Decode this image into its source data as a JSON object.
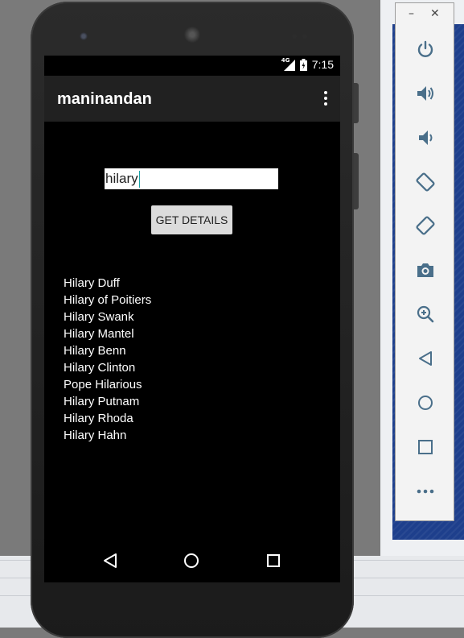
{
  "app": {
    "title": "maninandan",
    "menu_icon": "more-vert-icon"
  },
  "status_bar": {
    "network": "4G",
    "time": "7:15"
  },
  "search": {
    "value": "hilary"
  },
  "button": {
    "label": "GET DETAILS"
  },
  "results": [
    "Hilary Duff",
    "Hilary of Poitiers",
    "Hilary Swank",
    "Hilary Mantel",
    "Hilary Benn",
    "Hilary Clinton",
    "Pope Hilarious",
    "Hilary Putnam",
    "Hilary Rhoda",
    "Hilary Hahn"
  ],
  "nav_bar": [
    "back-icon",
    "home-icon",
    "recents-icon"
  ],
  "emulator_toolbar": {
    "window_controls": {
      "minimize": "–",
      "close": "✕"
    },
    "buttons": [
      "power-icon",
      "volume-up-icon",
      "volume-down-icon",
      "rotate-left-icon",
      "rotate-right-icon",
      "camera-icon",
      "zoom-icon",
      "back-icon",
      "home-icon",
      "overview-icon",
      "more-icon"
    ]
  },
  "colors": {
    "app_bar": "#212121",
    "button": "#dcdcdc",
    "accent": "#1aa2a6",
    "emulator_icon": "#4a6f8a"
  }
}
